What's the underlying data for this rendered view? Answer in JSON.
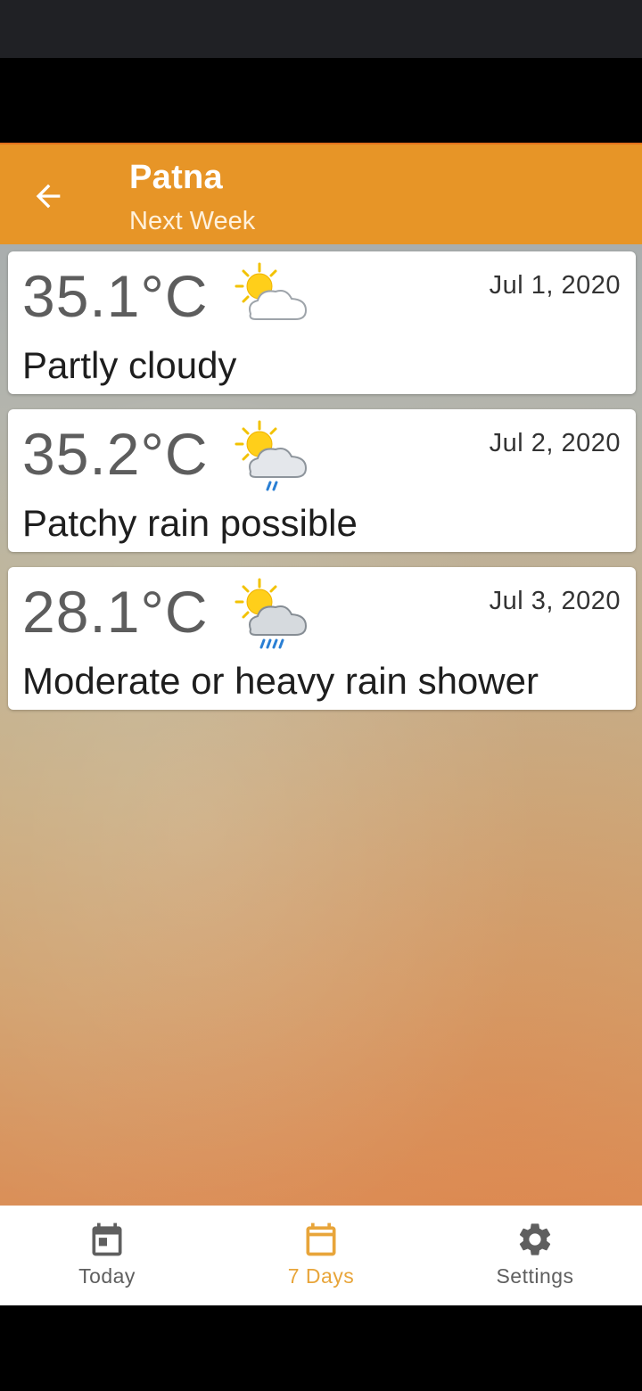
{
  "app_bar": {
    "title": "Patna",
    "subtitle": "Next Week",
    "back_icon": "arrow-left-icon",
    "color": "#e79527"
  },
  "forecast": [
    {
      "temp": "35.1°C",
      "date": "Jul 1, 2020",
      "condition": "Partly cloudy",
      "icon": "partly-cloudy-icon"
    },
    {
      "temp": "35.2°C",
      "date": "Jul 2, 2020",
      "condition": "Patchy rain possible",
      "icon": "patchy-rain-icon"
    },
    {
      "temp": "28.1°C",
      "date": "Jul 3, 2020",
      "condition": "Moderate or heavy rain shower",
      "icon": "heavy-rain-shower-icon"
    }
  ],
  "bottom_nav": {
    "items": [
      {
        "label": "Today",
        "icon": "calendar-today-icon",
        "active": false
      },
      {
        "label": "7 Days",
        "icon": "calendar-week-icon",
        "active": true
      },
      {
        "label": "Settings",
        "icon": "gear-icon",
        "active": false
      }
    ],
    "active_color": "#e8a53a",
    "inactive_color": "#5f5f5f"
  }
}
